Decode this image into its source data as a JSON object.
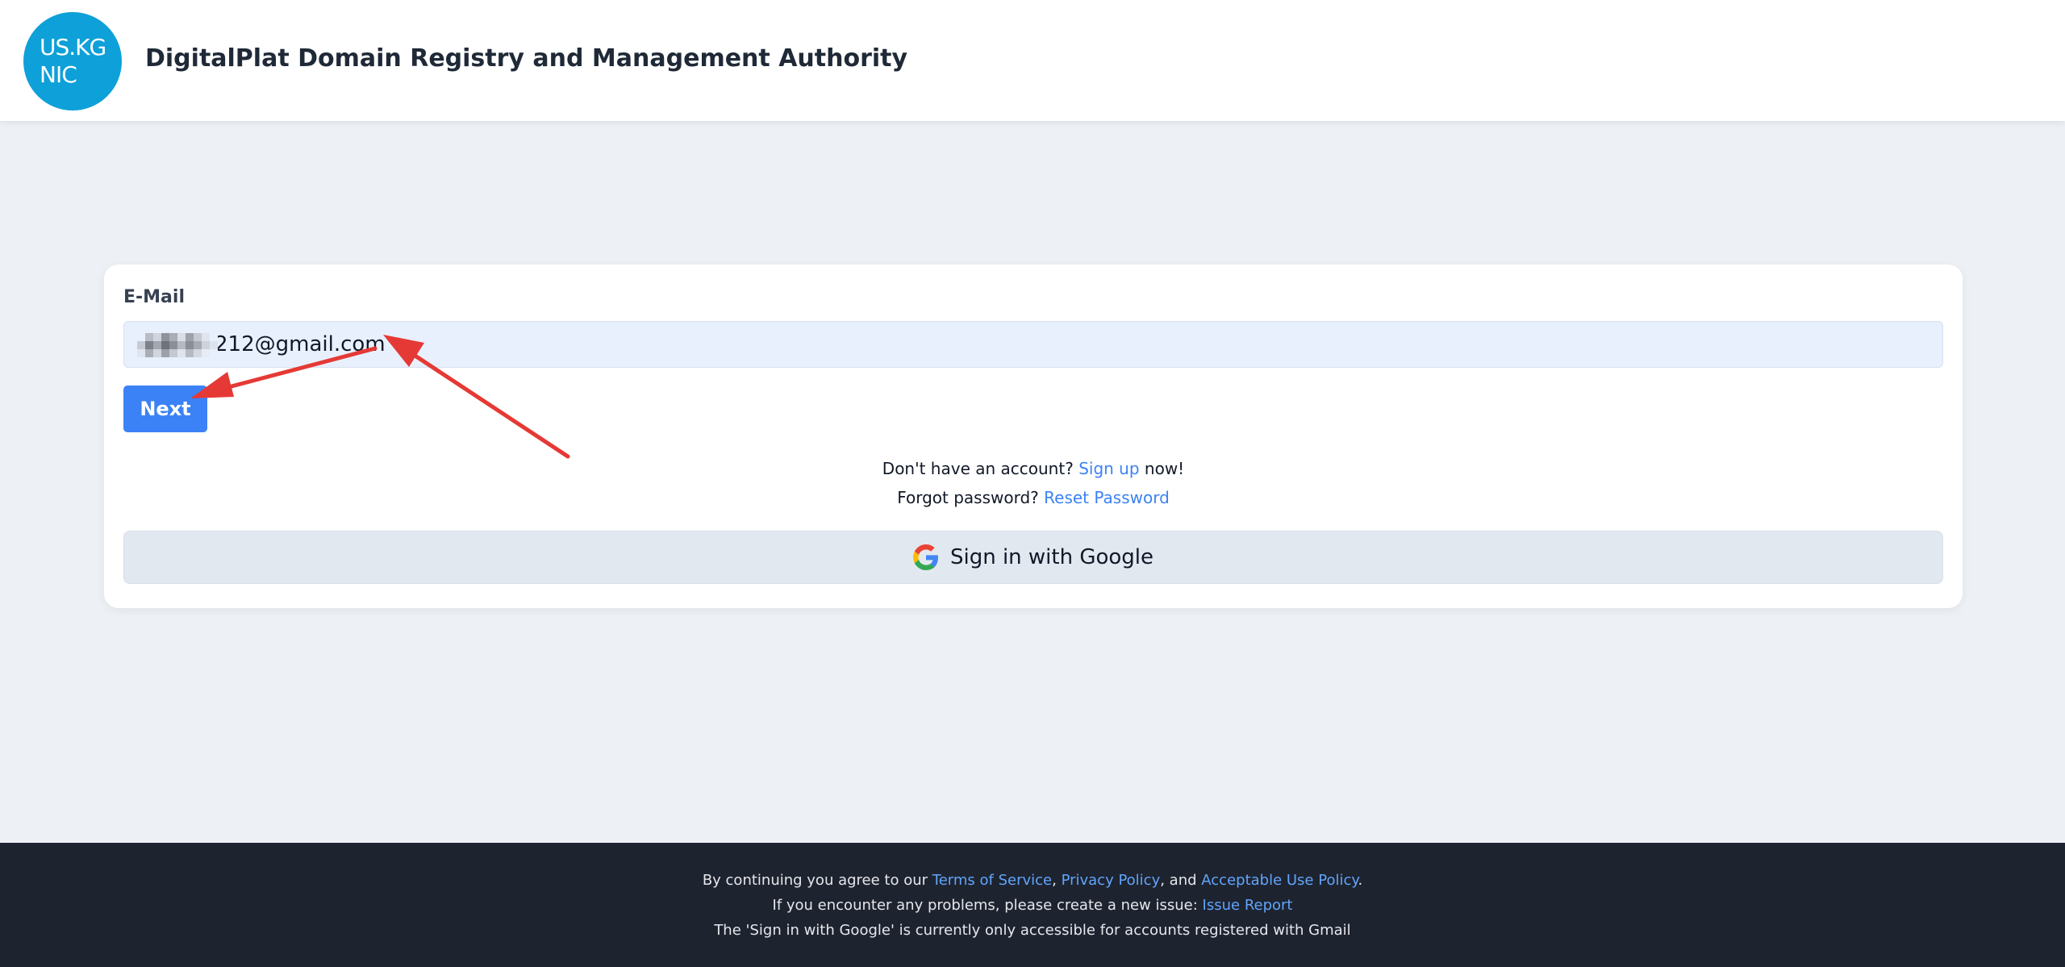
{
  "header": {
    "logo_line1": "US.KG",
    "logo_line2": "NIC",
    "title": "DigitalPlat Domain Registry and Management Authority"
  },
  "login_form": {
    "email_label": "E-Mail",
    "email_value": "212@gmail.com",
    "next_label": "Next",
    "signup_prefix": "Don't have an account?",
    "signup_link": "Sign up",
    "signup_suffix": "now!",
    "forgot_prefix": "Forgot password?",
    "forgot_link": "Reset Password",
    "google_label": "Sign in with Google",
    "google_icon": "google-g-icon"
  },
  "footer": {
    "line1_prefix": "By continuing you agree to our",
    "terms_link": "Terms of Service",
    "comma": ",",
    "privacy_link": "Privacy Policy",
    "and_text": ", and",
    "aup_link": "Acceptable Use Policy",
    "period": ".",
    "line2_prefix": "If you encounter any problems, please create a new issue:",
    "issue_link": "Issue Report",
    "line3": "The 'Sign in with Google' is currently only accessible for accounts registered with Gmail"
  },
  "colors": {
    "accent": "#3b82f6",
    "logo_bg": "#0ea0d8",
    "page_bg": "#edf1f5",
    "footer_bg": "#1e2330",
    "annotation_arrow": "#e53935"
  }
}
